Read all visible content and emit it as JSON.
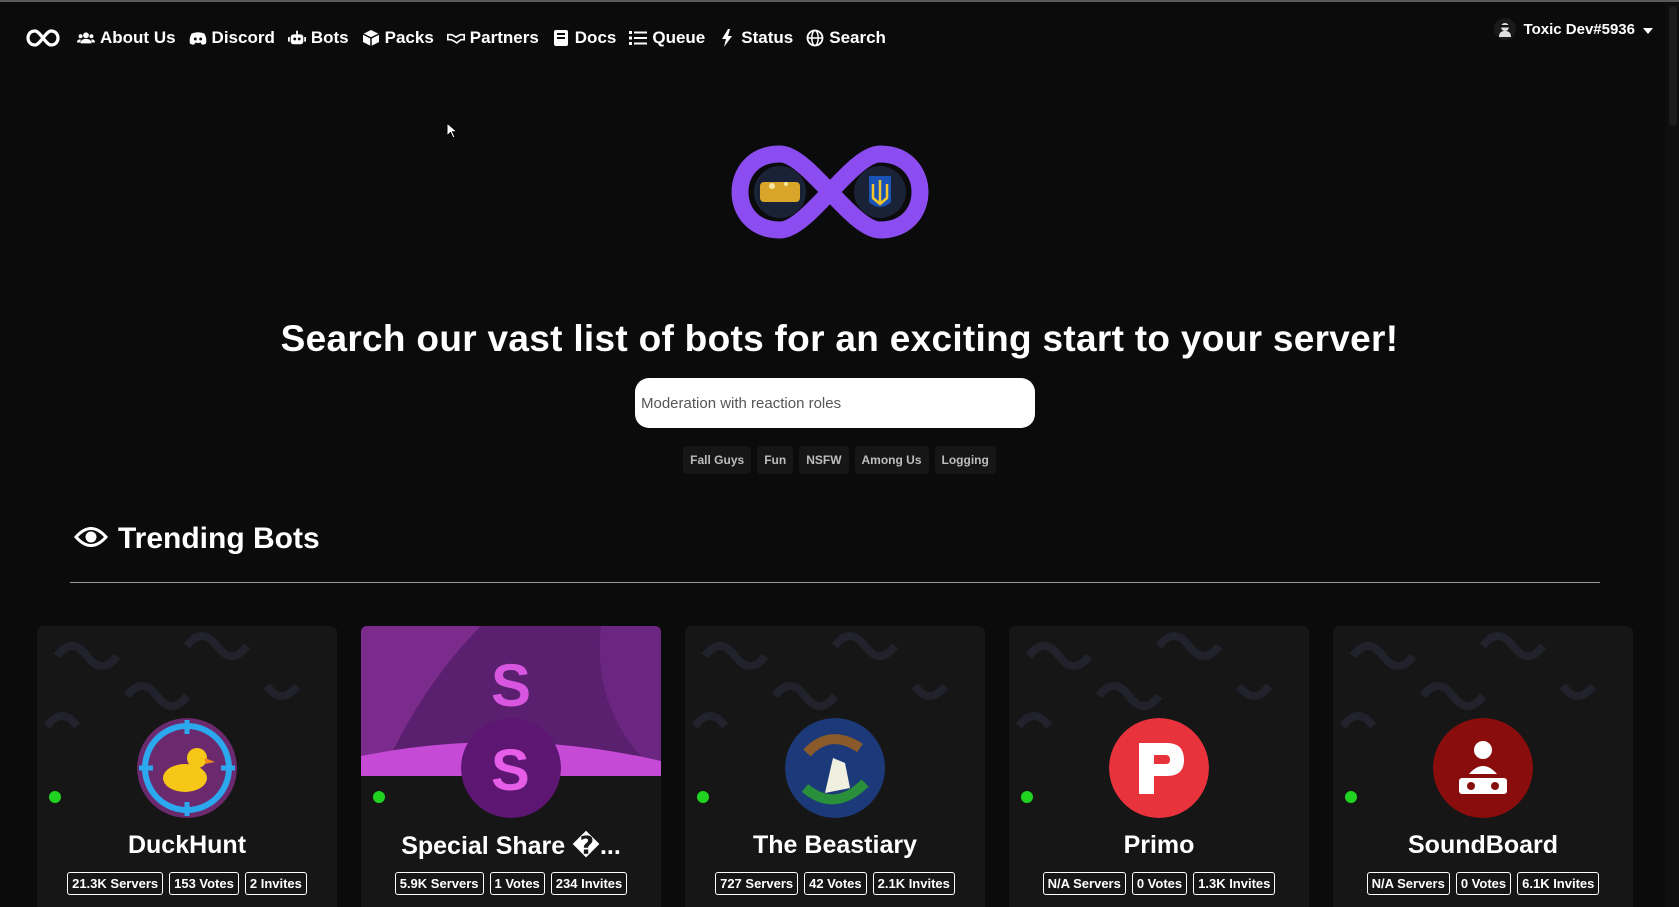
{
  "nav": {
    "items": [
      {
        "label": "About Us",
        "icon": "users-icon"
      },
      {
        "label": "Discord",
        "icon": "discord-icon"
      },
      {
        "label": "Bots",
        "icon": "robot-icon"
      },
      {
        "label": "Packs",
        "icon": "box-icon"
      },
      {
        "label": "Partners",
        "icon": "handshake-icon"
      },
      {
        "label": "Docs",
        "icon": "book-icon"
      },
      {
        "label": "Queue",
        "icon": "list-icon"
      },
      {
        "label": "Status",
        "icon": "bolt-icon"
      },
      {
        "label": "Search",
        "icon": "globe-icon"
      }
    ],
    "user": {
      "name": "Toxic Dev#5936"
    }
  },
  "hero": {
    "title": "Search our vast list of bots for an exciting start to your server!",
    "search_placeholder": "Moderation with reaction roles",
    "tags": [
      "Fall Guys",
      "Fun",
      "NSFW",
      "Among Us",
      "Logging"
    ]
  },
  "trending": {
    "title": "Trending Bots",
    "bots": [
      {
        "name": "DuckHunt",
        "servers": "21.3K Servers",
        "votes": "153 Votes",
        "invites": "2 Invites",
        "avatar_color": "#1e9ce0"
      },
      {
        "name": "Special Share �...",
        "servers": "5.9K Servers",
        "votes": "1 Votes",
        "invites": "234 Invites",
        "avatar_color": "#6a1a7a"
      },
      {
        "name": "The Beastiary",
        "servers": "727 Servers",
        "votes": "42 Votes",
        "invites": "2.1K Invites",
        "avatar_color": "#1c3a7a"
      },
      {
        "name": "Primo",
        "servers": "N/A Servers",
        "votes": "0 Votes",
        "invites": "1.3K Invites",
        "avatar_color": "#e8323c"
      },
      {
        "name": "SoundBoard",
        "servers": "N/A Servers",
        "votes": "0 Votes",
        "invites": "6.1K Invites",
        "avatar_color": "#8a0d0d"
      }
    ]
  },
  "colors": {
    "background": "#0b0b0b",
    "card": "#161616",
    "accent": "#7b3ff2",
    "online": "#21d321"
  }
}
